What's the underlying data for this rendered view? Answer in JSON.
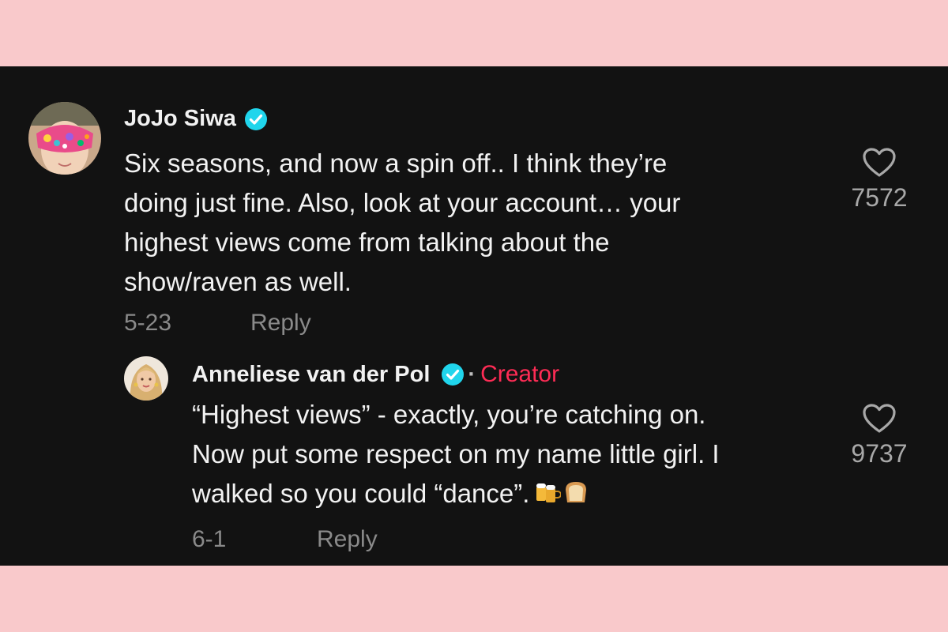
{
  "comments": [
    {
      "username": "JoJo Siwa",
      "verified": true,
      "text_lines": [
        "Six seasons, and now a spin off.. I think they’re",
        "doing just fine. Also, look at your account… your",
        "highest views come from talking about the",
        "show/raven as well."
      ],
      "date": "5-23",
      "reply_label": "Reply",
      "likes": "7572",
      "like_icon": "heart-outline-icon",
      "avatar": "avatar-colorful-mask"
    },
    {
      "username": "Anneliese van der Pol",
      "verified": true,
      "separator": "·",
      "creator_label": "Creator",
      "text_lines": [
        "“Highest views” - exactly, you’re catching on.",
        "Now put some respect on my name little girl. I",
        "walked so you could “dance”."
      ],
      "emojis": [
        "beer-mugs-emoji",
        "bread-emoji"
      ],
      "date": "6-1",
      "reply_label": "Reply",
      "likes": "9737",
      "like_icon": "heart-outline-icon",
      "avatar": "avatar-blonde-woman"
    }
  ],
  "colors": {
    "background_band": "#f9c9cb",
    "panel": "#121212",
    "text": "#f2f2f2",
    "meta": "#8a8a8a",
    "verified": "#20d5ec",
    "creator": "#fe2c55"
  }
}
